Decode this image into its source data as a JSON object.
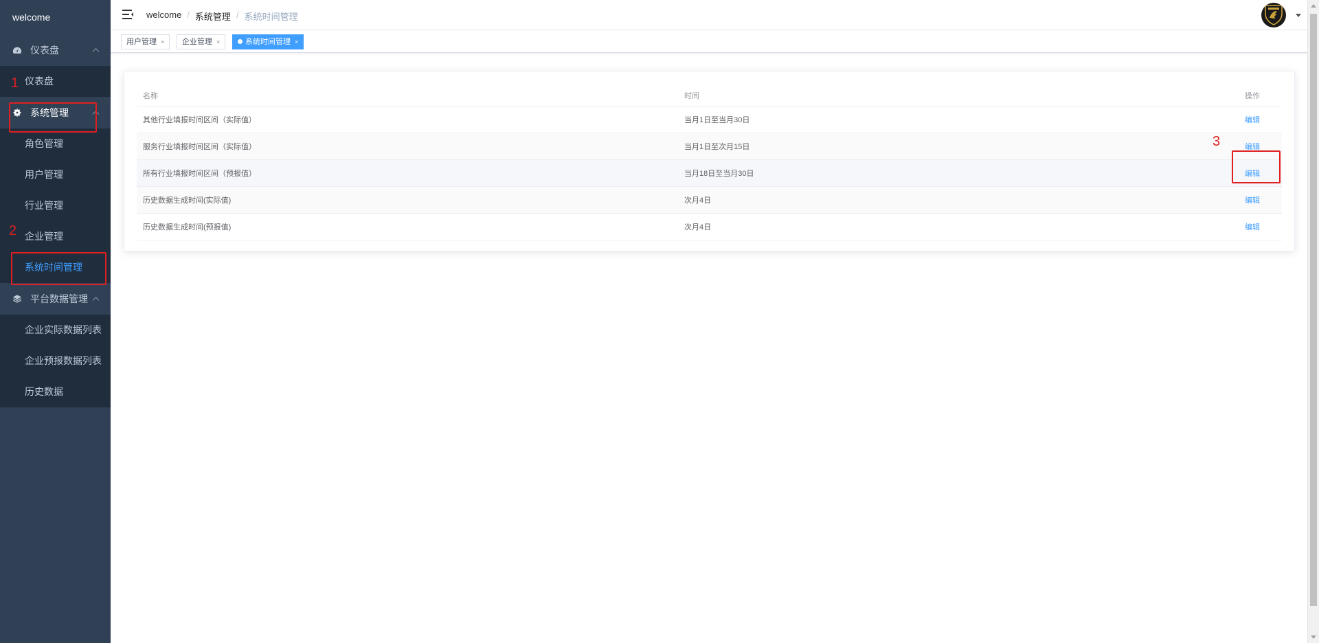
{
  "sidebar": {
    "logo": "welcome",
    "groups": [
      {
        "label": "仪表盘",
        "icon": "dashboard-icon",
        "items": [
          "仪表盘"
        ]
      },
      {
        "label": "系统管理",
        "icon": "gear-icon",
        "items": [
          "角色管理",
          "用户管理",
          "行业管理",
          "企业管理",
          "系统时间管理"
        ]
      },
      {
        "label": "平台数据管理",
        "icon": "layers-icon",
        "items": [
          "企业实际数据列表",
          "企业预报数据列表",
          "历史数据"
        ]
      }
    ],
    "active_item": "系统时间管理"
  },
  "breadcrumb": [
    "welcome",
    "系统管理",
    "系统时间管理"
  ],
  "tags": [
    {
      "label": "用户管理",
      "active": false
    },
    {
      "label": "企业管理",
      "active": false
    },
    {
      "label": "系统时间管理",
      "active": true
    }
  ],
  "table": {
    "headers": [
      "名称",
      "时间",
      "操作"
    ],
    "rows": [
      {
        "name": "其他行业填报时间区间（实际值）",
        "time": "当月1日至当月30日",
        "action": "编辑"
      },
      {
        "name": "服务行业填报时间区间（实际值）",
        "time": "当月1日至次月15日",
        "action": "编辑"
      },
      {
        "name": "所有行业填报时间区间（预报值）",
        "time": "当月18日至当月30日",
        "action": "编辑"
      },
      {
        "name": "历史数据生成时间(实际值)",
        "time": "次月4日",
        "action": "编辑"
      },
      {
        "name": "历史数据生成时间(预报值)",
        "time": "次月4日",
        "action": "编辑"
      }
    ]
  },
  "annotations": [
    "1",
    "2",
    "3"
  ],
  "colors": {
    "sidebar_bg": "#304156",
    "submenu_bg": "#1f2d3d",
    "accent": "#409eff",
    "annotation": "#e02020"
  }
}
